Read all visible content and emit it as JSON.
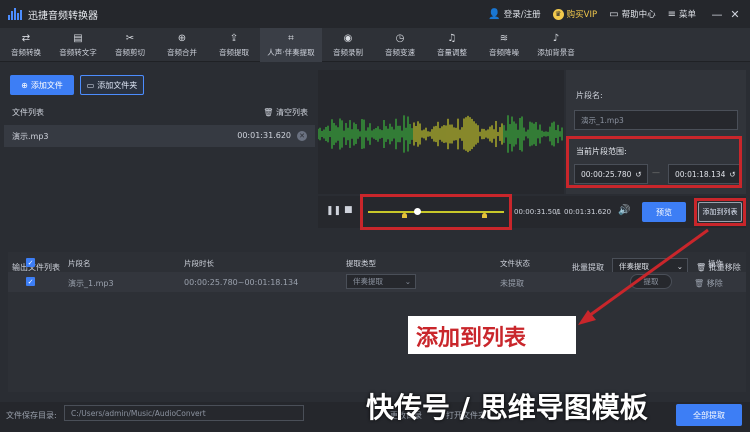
{
  "app": {
    "title": "迅捷音频转换器"
  },
  "topbar": {
    "login": "登录/注册",
    "vip": "购买VIP",
    "help": "帮助中心",
    "menu": "菜单",
    "minimize": "—",
    "close": "✕"
  },
  "toolbar": {
    "items": [
      {
        "label": "音频转换",
        "icon": "⇄"
      },
      {
        "label": "音频转文字",
        "icon": "▤"
      },
      {
        "label": "音频剪切",
        "icon": "✂"
      },
      {
        "label": "音频合并",
        "icon": "⊕"
      },
      {
        "label": "音频提取",
        "icon": "⇪"
      },
      {
        "label": "人声·伴奏提取",
        "icon": "⌗"
      },
      {
        "label": "音频录制",
        "icon": "◉"
      },
      {
        "label": "音频变速",
        "icon": "◷"
      },
      {
        "label": "音量调整",
        "icon": "♫"
      },
      {
        "label": "音频降噪",
        "icon": "≋"
      },
      {
        "label": "添加背景音",
        "icon": "♪"
      }
    ]
  },
  "left": {
    "add_file": "添加文件",
    "add_folder": "添加文件夹",
    "file_list": "文件列表",
    "clear": "清空列表",
    "files": [
      {
        "name": "演示.mp3",
        "duration": "00:01:31.620"
      }
    ]
  },
  "right": {
    "segment_name_label": "片段名:",
    "segment_name_value": "演示_1.mp3",
    "range_label": "当前片段范围:",
    "start": "00:00:25.780",
    "end": "00:01:18.134",
    "add_to_list": "添加到列表"
  },
  "player": {
    "current": "00:00:31.501",
    "separator": "/",
    "total": "00:01:31.620",
    "preview": "预览"
  },
  "output": {
    "title": "输出文件列表",
    "batch_label": "批量提取",
    "batch_value": "伴奏提取",
    "batch_remove": "批量移除",
    "headers": [
      "片段名",
      "片段时长",
      "提取类型",
      "文件状态",
      "操作"
    ],
    "rows": [
      {
        "name": "演示_1.mp3",
        "range": "00:00:25.780~00:01:18.134",
        "type": "伴奏提取",
        "status": "未提取",
        "extract": "提取",
        "remove": "移除"
      }
    ]
  },
  "bottom": {
    "save_label": "文件保存目录:",
    "save_path": "C:/Users/admin/Music/AudioConvert",
    "btn1": "更改目录",
    "btn2": "打开文件夹",
    "extract_all": "全部提取"
  },
  "annotation": {
    "callout": "添加到列表",
    "watermark": "快传号 / 思维导图模板"
  },
  "colors": {
    "accent": "#3d7ef5",
    "annotation_red": "#c9262b",
    "wave_green": "#3cb43c",
    "wave_yellow": "#c8c82a"
  }
}
